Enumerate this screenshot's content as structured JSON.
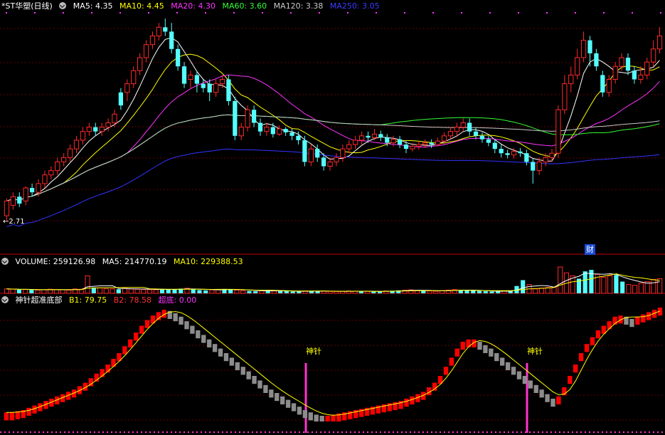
{
  "colors": {
    "up": "#ff2a2a",
    "down": "#54ffff",
    "ma5": "#ffffff",
    "ma10": "#ffff00",
    "ma20": "#ff33ff",
    "ma60": "#33ff33",
    "ma120": "#c8c8c8",
    "ma250": "#3333ff",
    "grid": "#8b0000",
    "sep": "#c00000",
    "b1": "#ff0000",
    "b2fall": "#8c8c8c",
    "b2line": "#ffff00",
    "marker": "#ff33cc",
    "purpleLabel": "#ff33ff"
  },
  "header": {
    "title": "*ST华塑(日线)",
    "ma5": "MA5: 4.35",
    "ma10": "MA10: 4.45",
    "ma20": "MA20: 4.30",
    "ma60": "MA60: 3.60",
    "ma120": "MA120: 3.38",
    "ma250": "MA250: 3.05"
  },
  "annotations": {
    "low_price": "2.71",
    "badge": "财",
    "signal1": "神针",
    "signal2": "神针"
  },
  "volume_header": {
    "title": "VOLUME: 259126.98",
    "ma5": "MA5: 214770.19",
    "ma10": "MA10: 229388.53"
  },
  "indicator_header": {
    "title": "神针超准底部",
    "b1": "B1: 79.75",
    "b2": "B2: 78.58",
    "chaodi": "超底: 0.00"
  },
  "chart_data": [
    {
      "type": "candlestick",
      "title": "*ST华塑(日线)",
      "ylim": [
        2.6,
        5.1
      ],
      "candles": [
        [
          2.78,
          2.95,
          2.72,
          2.98
        ],
        [
          2.9,
          3.0,
          2.85,
          3.05
        ],
        [
          3.0,
          2.92,
          2.88,
          3.05
        ],
        [
          2.95,
          3.1,
          2.9,
          3.12
        ],
        [
          3.1,
          3.05,
          3.0,
          3.15
        ],
        [
          3.05,
          3.15,
          3.0,
          3.2
        ],
        [
          3.15,
          3.25,
          3.1,
          3.3
        ],
        [
          3.25,
          3.3,
          3.2,
          3.35
        ],
        [
          3.3,
          3.4,
          3.25,
          3.45
        ],
        [
          3.4,
          3.45,
          3.35,
          3.5
        ],
        [
          3.45,
          3.55,
          3.4,
          3.6
        ],
        [
          3.55,
          3.65,
          3.5,
          3.7
        ],
        [
          3.65,
          3.75,
          3.6,
          3.8
        ],
        [
          3.75,
          3.8,
          3.7,
          3.85
        ],
        [
          3.8,
          3.75,
          3.7,
          3.85
        ],
        [
          3.75,
          3.8,
          3.7,
          3.85
        ],
        [
          3.8,
          3.85,
          3.75,
          3.9
        ],
        [
          3.85,
          3.95,
          3.8,
          4.0
        ],
        [
          4.2,
          4.05,
          4.0,
          4.25
        ],
        [
          4.2,
          4.3,
          4.1,
          4.35
        ],
        [
          4.3,
          4.45,
          4.25,
          4.5
        ],
        [
          4.45,
          4.6,
          4.4,
          4.65
        ],
        [
          4.6,
          4.75,
          4.55,
          4.8
        ],
        [
          4.75,
          4.85,
          4.7,
          4.9
        ],
        [
          4.85,
          4.95,
          4.8,
          5.0
        ],
        [
          4.95,
          4.9,
          4.85,
          5.05
        ],
        [
          4.9,
          4.7,
          4.65,
          5.0
        ],
        [
          4.7,
          4.5,
          4.45,
          4.75
        ],
        [
          4.5,
          4.3,
          4.25,
          4.55
        ],
        [
          4.35,
          4.4,
          4.25,
          4.45
        ],
        [
          4.4,
          4.3,
          4.2,
          4.45
        ],
        [
          4.3,
          4.25,
          4.2,
          4.35
        ],
        [
          4.3,
          4.2,
          4.1,
          4.35
        ],
        [
          4.2,
          4.3,
          4.15,
          4.35
        ],
        [
          4.3,
          4.35,
          4.25,
          4.4
        ],
        [
          4.35,
          4.1,
          4.05,
          4.4
        ],
        [
          4.1,
          3.7,
          3.65,
          4.15
        ],
        [
          3.7,
          3.8,
          3.65,
          3.85
        ],
        [
          3.8,
          4.0,
          3.75,
          4.05
        ],
        [
          4.0,
          3.85,
          3.8,
          4.05
        ],
        [
          3.85,
          3.75,
          3.7,
          3.9
        ],
        [
          3.75,
          3.8,
          3.7,
          3.85
        ],
        [
          3.8,
          3.72,
          3.68,
          3.85
        ],
        [
          3.72,
          3.78,
          3.7,
          3.82
        ],
        [
          3.78,
          3.74,
          3.7,
          3.8
        ],
        [
          3.74,
          3.7,
          3.65,
          3.78
        ],
        [
          3.7,
          3.65,
          3.6,
          3.75
        ],
        [
          3.65,
          3.4,
          3.35,
          3.7
        ],
        [
          3.4,
          3.55,
          3.35,
          3.6
        ],
        [
          3.55,
          3.45,
          3.4,
          3.6
        ],
        [
          3.45,
          3.35,
          3.3,
          3.5
        ],
        [
          3.35,
          3.4,
          3.3,
          3.45
        ],
        [
          3.4,
          3.45,
          3.35,
          3.5
        ],
        [
          3.45,
          3.55,
          3.4,
          3.6
        ],
        [
          3.55,
          3.6,
          3.5,
          3.65
        ],
        [
          3.6,
          3.65,
          3.55,
          3.7
        ],
        [
          3.65,
          3.7,
          3.6,
          3.75
        ],
        [
          3.7,
          3.68,
          3.62,
          3.75
        ],
        [
          3.68,
          3.72,
          3.65,
          3.78
        ],
        [
          3.72,
          3.68,
          3.64,
          3.76
        ],
        [
          3.68,
          3.62,
          3.58,
          3.72
        ],
        [
          3.62,
          3.66,
          3.58,
          3.7
        ],
        [
          3.66,
          3.6,
          3.56,
          3.7
        ],
        [
          3.6,
          3.55,
          3.5,
          3.64
        ],
        [
          3.55,
          3.58,
          3.52,
          3.62
        ],
        [
          3.58,
          3.6,
          3.54,
          3.64
        ],
        [
          3.6,
          3.62,
          3.56,
          3.66
        ],
        [
          3.62,
          3.6,
          3.56,
          3.66
        ],
        [
          3.6,
          3.64,
          3.58,
          3.68
        ],
        [
          3.64,
          3.7,
          3.6,
          3.74
        ],
        [
          3.7,
          3.75,
          3.66,
          3.8
        ],
        [
          3.75,
          3.8,
          3.7,
          3.85
        ],
        [
          3.8,
          3.85,
          3.75,
          3.9
        ],
        [
          3.85,
          3.75,
          3.7,
          3.9
        ],
        [
          3.75,
          3.7,
          3.66,
          3.8
        ],
        [
          3.7,
          3.66,
          3.62,
          3.74
        ],
        [
          3.66,
          3.62,
          3.58,
          3.7
        ],
        [
          3.62,
          3.55,
          3.5,
          3.66
        ],
        [
          3.55,
          3.5,
          3.45,
          3.6
        ],
        [
          3.5,
          3.48,
          3.44,
          3.54
        ],
        [
          3.48,
          3.52,
          3.44,
          3.56
        ],
        [
          3.52,
          3.5,
          3.46,
          3.56
        ],
        [
          3.5,
          3.4,
          3.36,
          3.54
        ],
        [
          3.4,
          3.3,
          3.15,
          3.44
        ],
        [
          3.3,
          3.4,
          3.25,
          3.45
        ],
        [
          3.4,
          3.45,
          3.35,
          3.5
        ],
        [
          3.45,
          3.5,
          3.4,
          3.55
        ],
        [
          3.5,
          4.0,
          3.45,
          4.05
        ],
        [
          4.0,
          4.3,
          3.95,
          4.4
        ],
        [
          4.3,
          4.4,
          4.2,
          4.5
        ],
        [
          4.4,
          4.6,
          4.35,
          4.7
        ],
        [
          4.6,
          4.8,
          4.55,
          4.9
        ],
        [
          4.8,
          4.65,
          4.5,
          4.85
        ],
        [
          4.65,
          4.5,
          4.45,
          4.7
        ],
        [
          4.4,
          4.2,
          4.15,
          4.45
        ],
        [
          4.2,
          4.35,
          4.15,
          4.4
        ],
        [
          4.35,
          4.5,
          4.3,
          4.55
        ],
        [
          4.5,
          4.6,
          4.45,
          4.65
        ],
        [
          4.6,
          4.45,
          4.4,
          4.65
        ],
        [
          4.45,
          4.35,
          4.3,
          4.5
        ],
        [
          4.35,
          4.4,
          4.3,
          4.5
        ],
        [
          4.4,
          4.55,
          4.35,
          4.6
        ],
        [
          4.55,
          4.7,
          4.5,
          4.8
        ],
        [
          4.7,
          4.85,
          4.65,
          4.95
        ]
      ]
    },
    {
      "type": "bar",
      "title": "VOLUME: 259126.98",
      "values": [
        30,
        28,
        25,
        26,
        24,
        22,
        25,
        28,
        26,
        24,
        22,
        30,
        28,
        120,
        40,
        38,
        32,
        30,
        28,
        35,
        30,
        28,
        26,
        25,
        24,
        30,
        28,
        26,
        32,
        35,
        28,
        22,
        20,
        24,
        26,
        30,
        28,
        22,
        18,
        16,
        14,
        18,
        20,
        16,
        15,
        14,
        12,
        14,
        16,
        18,
        15,
        14,
        13,
        12,
        14,
        16,
        15,
        14,
        13,
        12,
        14,
        16,
        18,
        20,
        22,
        24,
        20,
        18,
        16,
        14,
        18,
        22,
        26,
        24,
        20,
        18,
        16,
        14,
        12,
        14,
        16,
        18,
        50,
        90,
        60,
        30,
        36,
        40,
        42,
        180,
        140,
        120,
        100,
        150,
        160,
        130,
        110,
        120,
        125,
        80,
        60,
        55,
        70,
        80,
        95,
        100
      ]
    },
    {
      "type": "bar",
      "title": "神针超准底部",
      "values": [
        8,
        8,
        9,
        10,
        12,
        14,
        16,
        18,
        20,
        22,
        24,
        26,
        28,
        31,
        34,
        38,
        42,
        46,
        50,
        55,
        60,
        66,
        72,
        78,
        84,
        89,
        93,
        96,
        98,
        97,
        95,
        92,
        88,
        84,
        80,
        76,
        72,
        68,
        64,
        60,
        56,
        52,
        48,
        44,
        40,
        36,
        32,
        28,
        25,
        22,
        19,
        16,
        13,
        10,
        8,
        6,
        5,
        5,
        6,
        7,
        8,
        9,
        10,
        11,
        12,
        13,
        14,
        15,
        16,
        17,
        18,
        20,
        22,
        24,
        26,
        30,
        34,
        40,
        48,
        56,
        64,
        70,
        72,
        72,
        70,
        67,
        64,
        60,
        56,
        52,
        48,
        44,
        40,
        36,
        32,
        28,
        24,
        20,
        22,
        30,
        40,
        50,
        60,
        68,
        74,
        80,
        84,
        88,
        92,
        93,
        92,
        90,
        92,
        94,
        96,
        98,
        100
      ]
    }
  ]
}
